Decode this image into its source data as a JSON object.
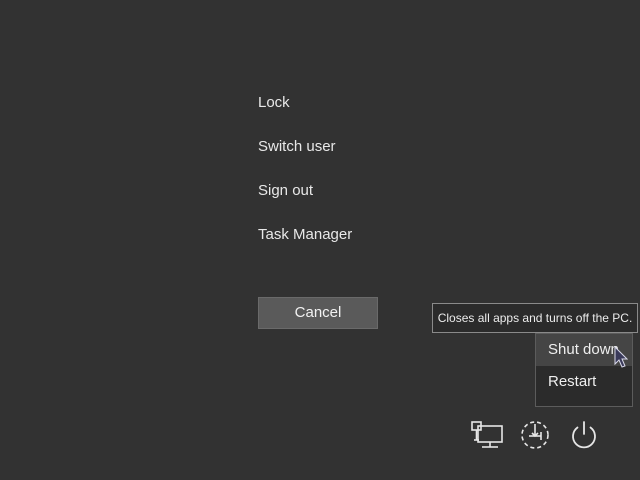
{
  "menu": {
    "items": [
      {
        "label": "Lock"
      },
      {
        "label": "Switch user"
      },
      {
        "label": "Sign out"
      },
      {
        "label": "Task Manager"
      }
    ],
    "cancel_label": "Cancel"
  },
  "tooltip": {
    "text": "Closes all apps and turns off the PC."
  },
  "power_menu": {
    "options": [
      {
        "label": "Shut down",
        "highlighted": true
      },
      {
        "label": "Restart",
        "highlighted": false
      }
    ]
  },
  "bottom_icons": [
    {
      "icon": "network-icon"
    },
    {
      "icon": "ease-of-access-icon"
    },
    {
      "icon": "power-icon"
    }
  ],
  "colors": {
    "background": "#323232",
    "button": "#5a5a5a",
    "menu_highlight": "#454545"
  }
}
